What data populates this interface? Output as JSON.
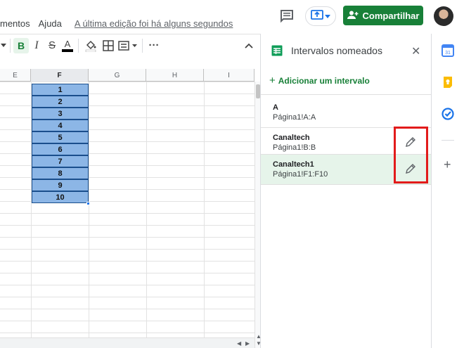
{
  "menu": {
    "items": [
      "mentos",
      "Ajuda"
    ],
    "last_edit": "A última edição foi há alguns segundos"
  },
  "header": {
    "share_label": "Compartilhar",
    "accent_color": "#188038",
    "icons": [
      "comment-icon",
      "present-icon",
      "avatar"
    ]
  },
  "toolbar": {
    "bold": "B",
    "italic": "I",
    "strike": "S",
    "text_color": "A",
    "more": "···",
    "collapse": "^"
  },
  "sheet": {
    "columns": [
      "E",
      "F",
      "G",
      "H",
      "I"
    ],
    "active_column": "F",
    "selected_values": [
      "1",
      "2",
      "3",
      "4",
      "5",
      "6",
      "7",
      "8",
      "9",
      "10"
    ],
    "selection_color": "#8cb6e6"
  },
  "panel": {
    "title": "Intervalos nomeados",
    "close": "✕",
    "add_label": "Adicionar um intervalo",
    "ranges": [
      {
        "name": "A",
        "ref": "Página1!A:A",
        "selected": false
      },
      {
        "name": "Canaltech",
        "ref": "Página1!B:B",
        "selected": false
      },
      {
        "name": "Canaltech1",
        "ref": "Página1!F1:F10",
        "selected": true
      }
    ]
  },
  "side_strip": {
    "icons": [
      "calendar-icon",
      "keep-icon",
      "tasks-icon",
      "add-icon"
    ],
    "calendar_day": "31"
  }
}
